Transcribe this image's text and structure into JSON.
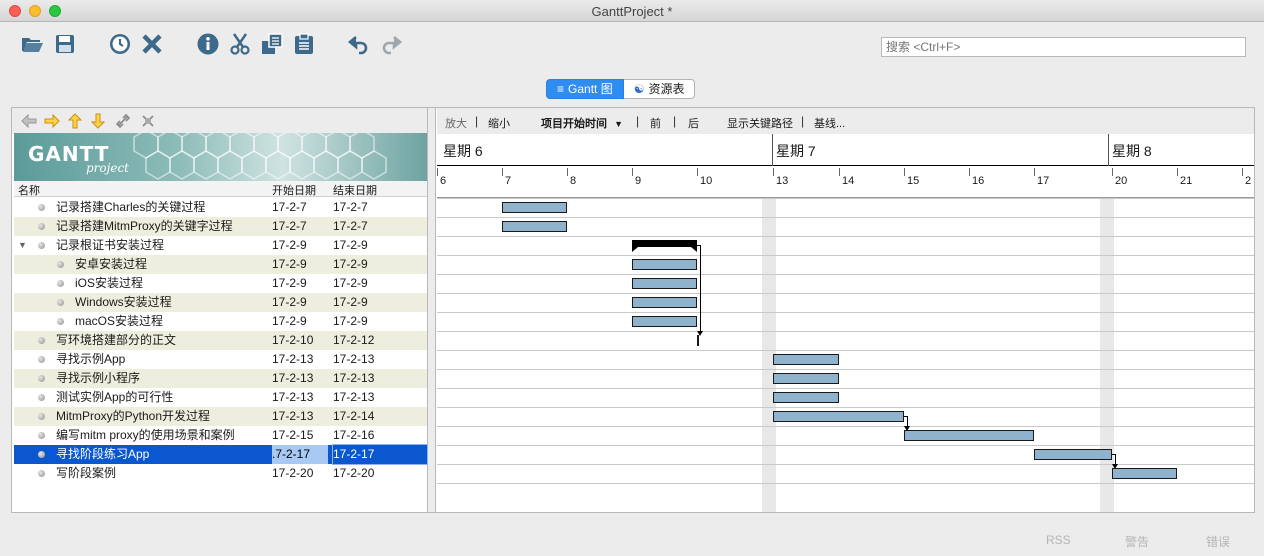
{
  "window": {
    "title": "GanttProject *"
  },
  "toolbar": {
    "icons": [
      "open-folder-icon",
      "save-icon",
      "clock-icon",
      "close-x-icon",
      "info-icon",
      "scissors-icon",
      "copy-icon",
      "paste-icon",
      "undo-icon",
      "redo-icon"
    ]
  },
  "search": {
    "placeholder": "搜索 <Ctrl+F>"
  },
  "tabs": {
    "gantt": "Gantt 图",
    "resources": "资源表"
  },
  "logo": {
    "word": "GANTT",
    "sub": "project"
  },
  "columns": {
    "name": "名称",
    "start": "开始日期",
    "end": "结束日期"
  },
  "tasks": [
    {
      "name": "记录搭建Charles的关键过程",
      "start": "17-2-7",
      "end": "17-2-7",
      "level": 0
    },
    {
      "name": "记录搭建MitmProxy的关键字过程",
      "start": "17-2-7",
      "end": "17-2-7",
      "level": 0
    },
    {
      "name": "记录根证书安装过程",
      "start": "17-2-9",
      "end": "17-2-9",
      "level": 0,
      "expanded": true
    },
    {
      "name": "安卓安装过程",
      "start": "17-2-9",
      "end": "17-2-9",
      "level": 1
    },
    {
      "name": "iOS安装过程",
      "start": "17-2-9",
      "end": "17-2-9",
      "level": 1
    },
    {
      "name": "Windows安装过程",
      "start": "17-2-9",
      "end": "17-2-9",
      "level": 1
    },
    {
      "name": "macOS安装过程",
      "start": "17-2-9",
      "end": "17-2-9",
      "level": 1
    },
    {
      "name": "写环境搭建部分的正文",
      "start": "17-2-10",
      "end": "17-2-12",
      "level": 0
    },
    {
      "name": "寻找示例App",
      "start": "17-2-13",
      "end": "17-2-13",
      "level": 0
    },
    {
      "name": "寻找示例小程序",
      "start": "17-2-13",
      "end": "17-2-13",
      "level": 0
    },
    {
      "name": "测试实例App的可行性",
      "start": "17-2-13",
      "end": "17-2-13",
      "level": 0
    },
    {
      "name": "MitmProxy的Python开发过程",
      "start": "17-2-13",
      "end": "17-2-14",
      "level": 0
    },
    {
      "name": "编写mitm proxy的使用场景和案例",
      "start": "17-2-15",
      "end": "17-2-16",
      "level": 0
    },
    {
      "name": "寻找阶段练习App",
      "start": ".7-2-17",
      "end": "17-2-17",
      "level": 0,
      "selected": true
    },
    {
      "name": "写阶段案例",
      "start": "17-2-20",
      "end": "17-2-20",
      "level": 0
    }
  ],
  "chart_toolbar": {
    "zoom_in": "放大",
    "zoom_out": "缩小",
    "project_start": "项目开始时间",
    "prev": "前",
    "next": "后",
    "critical_path": "显示关键路径",
    "baseline": "基线..."
  },
  "timeline": {
    "weeks": [
      "星期 6",
      "星期 7",
      "星期 8"
    ],
    "days": [
      "6",
      "7",
      "8",
      "9",
      "10",
      "13",
      "14",
      "15",
      "16",
      "17",
      "20",
      "21",
      "2"
    ]
  },
  "status": {
    "rss": "RSS",
    "warnings": "警告",
    "errors": "错误"
  },
  "colors": {
    "bar": "#8fb3cc",
    "selection": "#0b57d0",
    "accent": "#2f8cf0"
  }
}
